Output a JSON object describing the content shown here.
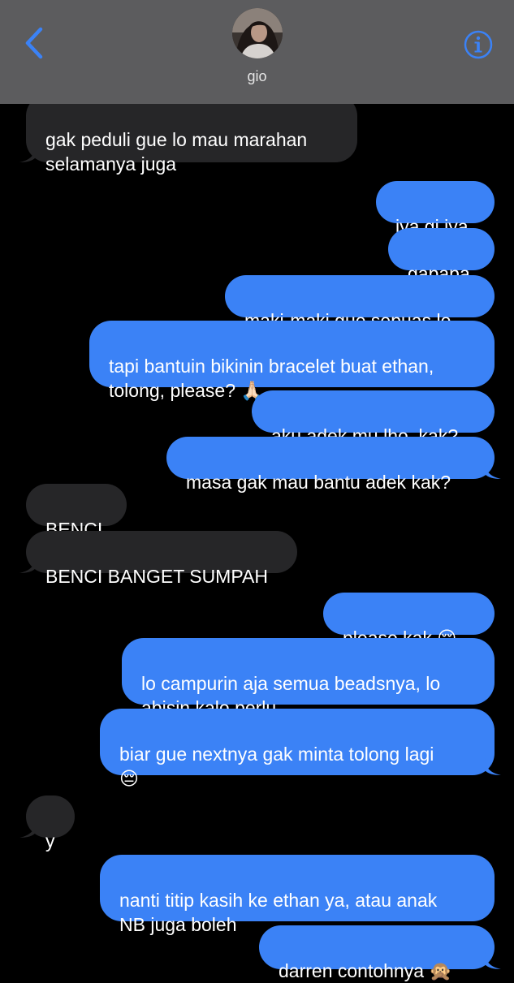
{
  "header": {
    "contact_name": "gio",
    "back_icon": "chevron-left-icon",
    "info_icon": "info-circle-icon",
    "accent_color": "#3b82f6"
  },
  "messages": [
    {
      "direction": "in",
      "text": "gak peduli gue lo mau marahan\nselamanya juga",
      "tail": true
    },
    {
      "direction": "out",
      "text": "iya gi iya",
      "tail": false
    },
    {
      "direction": "out",
      "text": "gapapa",
      "tail": false
    },
    {
      "direction": "out",
      "text": "maki-maki gue sepuas lo",
      "tail": false
    },
    {
      "direction": "out",
      "text": "tapi bantuin bikinin bracelet buat ethan,\ntolong, please? 🙏🏻",
      "tail": false
    },
    {
      "direction": "out",
      "text": "aku adek mu lho, kak?",
      "tail": false
    },
    {
      "direction": "out",
      "text": "masa gak mau bantu adek kak?",
      "tail": true
    },
    {
      "direction": "in",
      "text": "BENCI",
      "tail": false
    },
    {
      "direction": "in",
      "text": "BENCI BANGET SUMPAH",
      "tail": true
    },
    {
      "direction": "out",
      "text": "please kak 😔",
      "tail": false
    },
    {
      "direction": "out",
      "text": "lo campurin aja semua beadsnya, lo\nabisin kalo perlu",
      "tail": false
    },
    {
      "direction": "out",
      "text": "biar gue nextnya gak minta tolong lagi\n😔",
      "tail": true
    },
    {
      "direction": "in",
      "text": "y",
      "tail": true
    },
    {
      "direction": "out",
      "text": "nanti titip kasih ke ethan ya, atau anak\nNB juga boleh",
      "tail": false
    },
    {
      "direction": "out",
      "text": "darren contohnya 🙊",
      "tail": true
    }
  ],
  "colors": {
    "outgoing_bubble": "#3b82f6",
    "incoming_bubble": "#262628",
    "header_background": "#5c5c5e",
    "chat_background": "#000000"
  }
}
